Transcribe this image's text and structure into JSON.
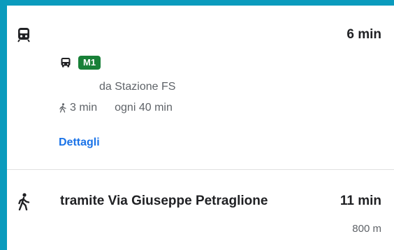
{
  "transit_route": {
    "icon": "train-icon",
    "duration": "6 min",
    "leg_icon": "bus-icon",
    "line_badge": "M1",
    "line_color": "#188038",
    "departure": "da Stazione FS",
    "walk_icon": "walk-icon",
    "walk_time": "3 min",
    "frequency": "ogni 40 min",
    "details_link": "Dettagli",
    "link_color": "#1a73e8"
  },
  "walking_route": {
    "icon": "walk-icon",
    "description": "tramite Via Giuseppe Petraglione",
    "duration": "11 min",
    "distance": "800 m"
  }
}
